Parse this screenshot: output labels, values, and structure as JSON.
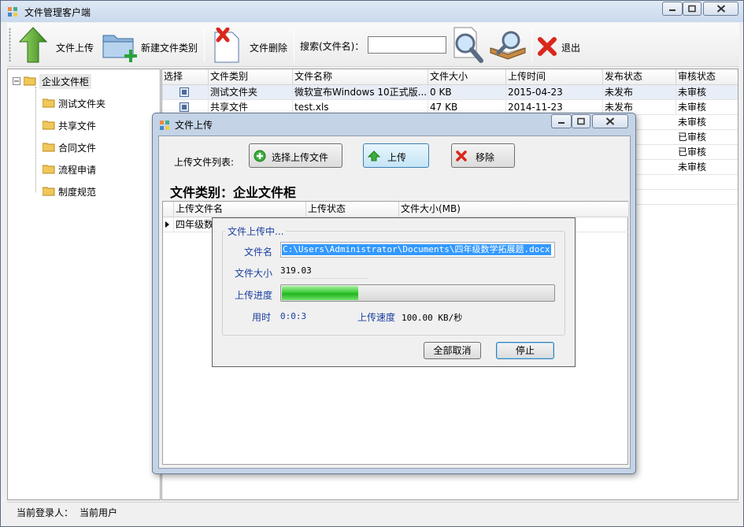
{
  "window": {
    "title": "文件管理客户端"
  },
  "toolbar": {
    "upload_label": "文件上传",
    "new_category_label": "新建文件类别",
    "delete_label": "文件删除",
    "search_label": "搜索(文件名)：",
    "search_value": "",
    "exit_label": "退出"
  },
  "tree": {
    "root": "企业文件柜",
    "children": [
      "测试文件夹",
      "共享文件",
      "合同文件",
      "流程申请",
      "制度规范"
    ]
  },
  "grid": {
    "columns": [
      "选择",
      "文件类别",
      "文件名称",
      "文件大小",
      "上传时间",
      "发布状态",
      "审核状态"
    ],
    "rows": [
      {
        "category": "测试文件夹",
        "name": "微软宣布Windows 10正式版...",
        "size": "0 KB",
        "date": "2015-04-23",
        "publish": "未发布",
        "review": "未审核"
      },
      {
        "category": "共享文件",
        "name": "test.xls",
        "size": "47 KB",
        "date": "2014-11-23",
        "publish": "未发布",
        "review": "未审核"
      },
      {
        "category": "",
        "name": "",
        "size": "",
        "date": "",
        "publish": "",
        "review": "未审核"
      },
      {
        "category": "",
        "name": "",
        "size": "",
        "date": "",
        "publish": "",
        "review": "已审核"
      },
      {
        "category": "",
        "name": "",
        "size": "",
        "date": "",
        "publish": "",
        "review": "已审核"
      },
      {
        "category": "",
        "name": "",
        "size": "",
        "date": "",
        "publish": "",
        "review": "未审核"
      }
    ]
  },
  "status": {
    "login_label": "当前登录人：",
    "login_user": "当前用户"
  },
  "dialog": {
    "title": "文件上传",
    "list_label": "上传文件列表:",
    "select_button": "选择上传文件",
    "upload_button": "上传",
    "remove_button": "移除",
    "category_heading": "文件类别：企业文件柜",
    "columns": [
      "上传文件名",
      "上传状态",
      "文件大小(MB)"
    ],
    "row_name": "四年级数"
  },
  "progress_popup": {
    "group_title": "文件上传中...",
    "filename_label": "文件名",
    "filename_value": "C:\\Users\\Administrator\\Documents\\四年级数学拓展题.docx",
    "size_label": "文件大小",
    "size_value": "319.03",
    "progress_label": "上传进度",
    "progress_fraction": 0.28,
    "elapsed_label": "用时",
    "elapsed_value": "0:0:3",
    "speed_label": "上传速度",
    "speed_value": "100.00 KB/秒",
    "cancel_all_button": "全部取消",
    "stop_button": "停止"
  },
  "colors": {
    "progress_green": "#22b51e",
    "label_blue": "#1a3fa0",
    "selection_blue": "#3399ff"
  }
}
